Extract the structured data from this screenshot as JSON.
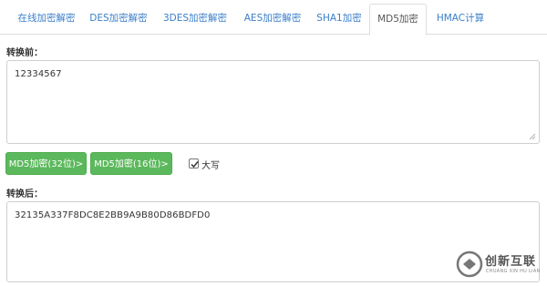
{
  "tabs": [
    {
      "label": "在线加密解密",
      "active": false
    },
    {
      "label": "DES加密解密",
      "active": false
    },
    {
      "label": "3DES加密解密",
      "active": false
    },
    {
      "label": "AES加密解密",
      "active": false
    },
    {
      "label": "SHA1加密",
      "active": false
    },
    {
      "label": "MD5加密",
      "active": true
    },
    {
      "label": "HMAC计算",
      "active": false
    }
  ],
  "input": {
    "label": "转换前：",
    "value": "12334567"
  },
  "actions": {
    "md5_32_label": "MD5加密(32位)>",
    "md5_16_label": "MD5加密(16位)>",
    "uppercase_label": "大写",
    "uppercase_checked": true
  },
  "output": {
    "label": "转换后：",
    "value": "32135A337F8DC8E2BB9A9B80D86BDFD0"
  },
  "watermark": {
    "title": "创新互联",
    "subtitle": "CHUANG XIN HU LIAN"
  },
  "colors": {
    "accent_green": "#5cb85c",
    "link_blue": "#3a7ec9"
  }
}
